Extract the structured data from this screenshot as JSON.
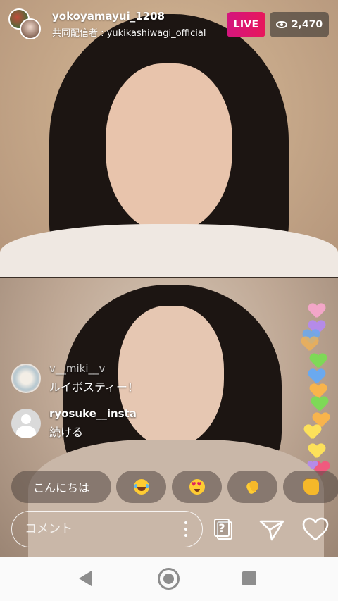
{
  "header": {
    "host_username": "yokoyamayui_1208",
    "cohost_label": "共同配信者 : yukikashiwagi_official",
    "live_label": "LIVE",
    "viewer_count": "2,470"
  },
  "comments": [
    {
      "username": "v__miki__v",
      "text": "ルイボスティー！"
    },
    {
      "username": "ryosuke__insta",
      "text": "続ける"
    }
  ],
  "quick_replies": {
    "text_chip": "こんにちは",
    "emoji_chips": [
      "laughing-tears-emoji",
      "heart-eyes-emoji",
      "clapping-hands-emoji",
      "thumbs-up-emoji"
    ]
  },
  "composer": {
    "placeholder": "コメント"
  },
  "icons": {
    "question_box": "question-sticker-icon",
    "send": "paper-plane-icon",
    "like": "heart-outline-icon"
  },
  "colors": {
    "live_gradient_start": "#d3167e",
    "live_gradient_end": "#e8175b",
    "hearts": [
      "#f3a6c8",
      "#b58be8",
      "#6aa9ef",
      "#7ed957",
      "#f8b44c",
      "#fce15a",
      "#f05a7e"
    ]
  }
}
